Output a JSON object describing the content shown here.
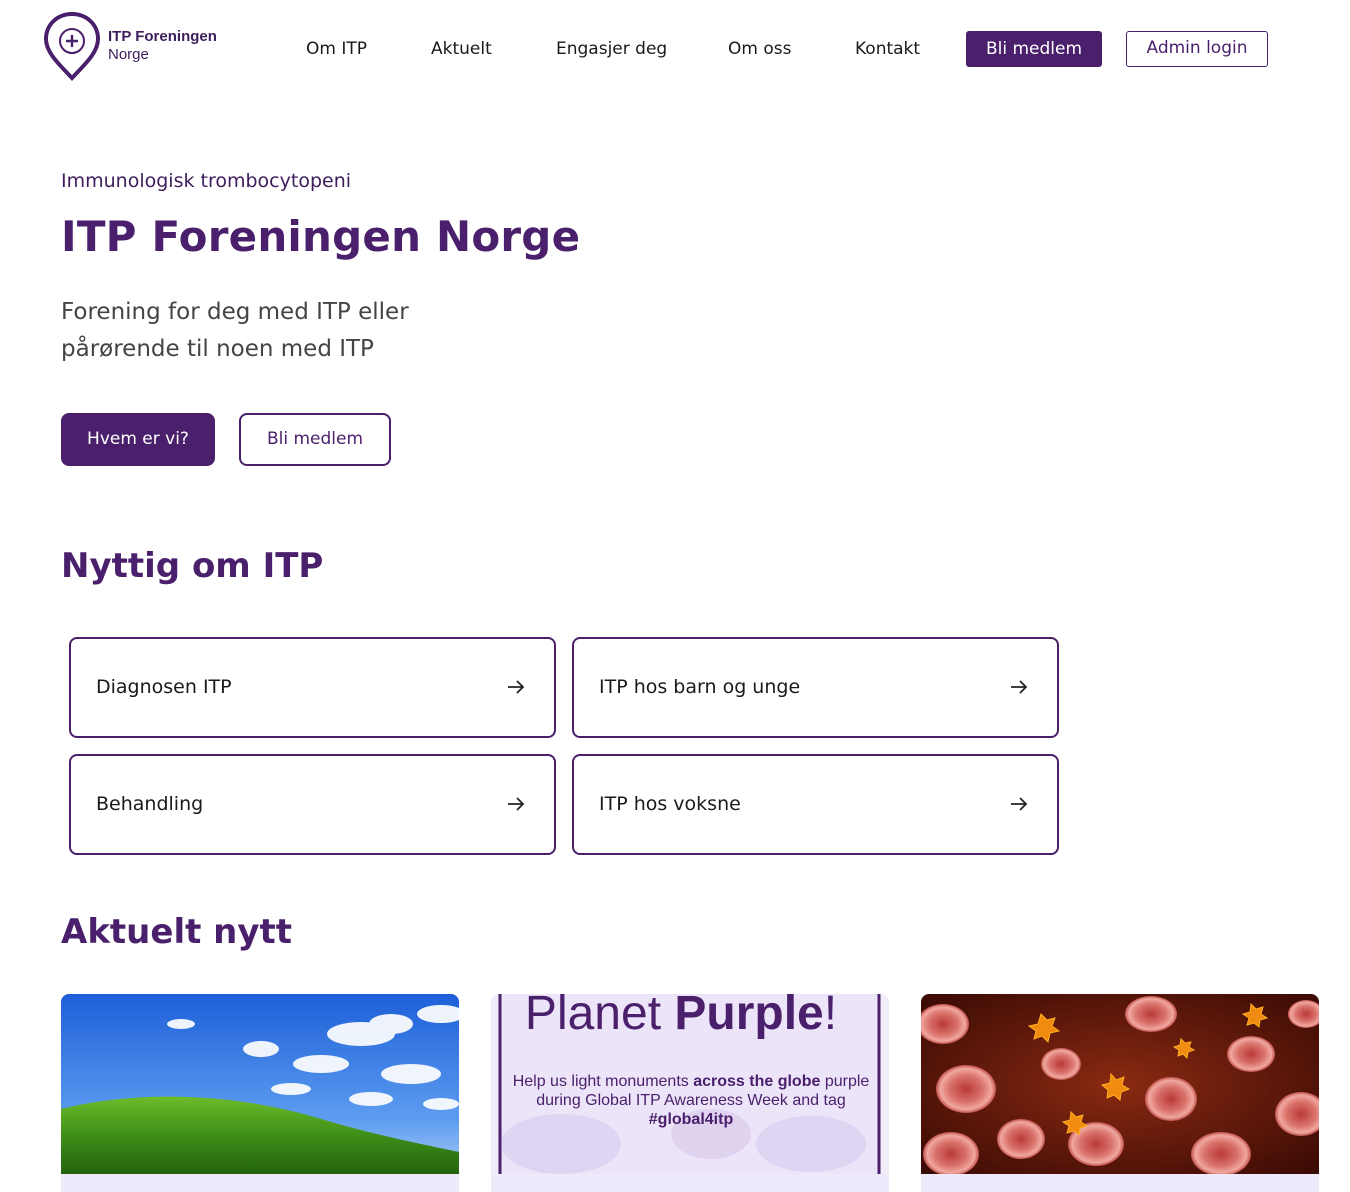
{
  "brand": {
    "name_line1": "ITP Foreningen",
    "name_line2": "Norge",
    "logo_icon": "map-pin-plus-icon",
    "primary_color": "#4a1f6b"
  },
  "nav": {
    "items": [
      "Om ITP",
      "Aktuelt",
      "Engasjer deg",
      "Om oss",
      "Kontakt"
    ],
    "join_label": "Bli medlem",
    "admin_label": "Admin login"
  },
  "hero": {
    "eyebrow": "Immunologisk trombocytopeni",
    "title": "ITP Foreningen Norge",
    "subtitle": "Forening for deg med ITP eller pårørende til noen med ITP",
    "primary_button": "Hvem er vi?",
    "secondary_button": "Bli medlem"
  },
  "useful": {
    "title": "Nyttig om ITP",
    "cards": [
      {
        "label": "Diagnosen ITP",
        "icon": "arrow-right-icon"
      },
      {
        "label": "ITP hos barn og unge",
        "icon": "arrow-right-icon"
      },
      {
        "label": "Behandling",
        "icon": "arrow-right-icon"
      },
      {
        "label": "ITP hos voksne",
        "icon": "arrow-right-icon"
      }
    ]
  },
  "news": {
    "title": "Aktuelt nytt",
    "items": [
      {
        "image": "green-hill-blue-sky-image"
      },
      {
        "image": "planet-purple-poster-image",
        "poster_title_a": "Planet ",
        "poster_title_b": "Purple",
        "poster_title_c": "!",
        "poster_text_a": "Help us light monuments ",
        "poster_text_b": "across the globe",
        "poster_text_c": " purple during Global ITP Awareness Week and tag ",
        "poster_text_d": "#global4itp"
      },
      {
        "image": "blood-cells-platelets-image"
      }
    ]
  }
}
